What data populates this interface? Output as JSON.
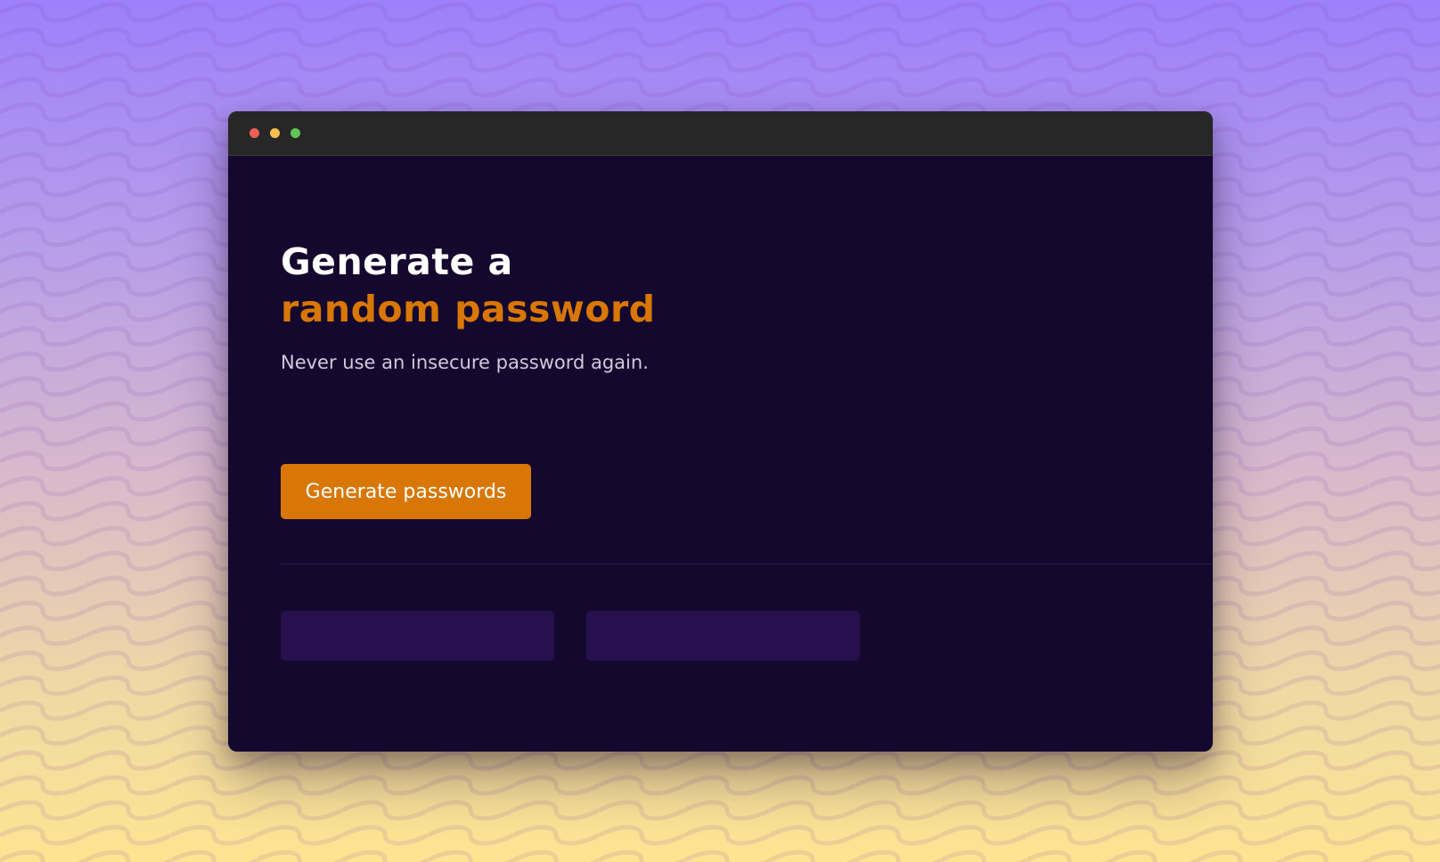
{
  "colors": {
    "window_bg": "#15082e",
    "titlebar_bg": "#272727",
    "accent": "#d97706",
    "password_box_bg": "#27104e",
    "close_dot": "#ee5f57",
    "minimize_dot": "#f4bf4f",
    "maximize_dot": "#61c554"
  },
  "window_controls": [
    {
      "name": "close",
      "icon": "close-dot-icon"
    },
    {
      "name": "minimize",
      "icon": "minimize-dot-icon"
    },
    {
      "name": "maximize",
      "icon": "maximize-dot-icon"
    }
  ],
  "hero": {
    "title_line1": "Generate a",
    "title_line2": "random password",
    "subtitle": "Never use an insecure password again."
  },
  "actions": {
    "generate_label": "Generate passwords"
  },
  "passwords": [
    "",
    ""
  ]
}
